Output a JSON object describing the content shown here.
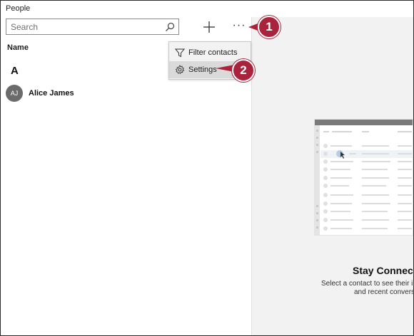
{
  "app": {
    "title": "People"
  },
  "search": {
    "placeholder": "Search"
  },
  "toolbar": {
    "add_icon": "plus-icon",
    "more_label": "···"
  },
  "list": {
    "column_header": "Name",
    "groups": [
      {
        "letter": "A",
        "contacts": [
          {
            "initials": "AJ",
            "name": "Alice James"
          }
        ]
      }
    ]
  },
  "menu": {
    "items": [
      {
        "label": "Filter contacts",
        "icon": "filter-icon"
      },
      {
        "label": "Settings",
        "icon": "gear-icon"
      }
    ]
  },
  "empty_state": {
    "title": "Stay Connec",
    "line1": "Select a contact to see their inf",
    "line2": "and recent conversa"
  },
  "callouts": [
    {
      "number": "1"
    },
    {
      "number": "2"
    }
  ],
  "colors": {
    "callout": "#a8233b",
    "avatar": "#6b6b6b",
    "right_pane": "#f2f2f2"
  }
}
